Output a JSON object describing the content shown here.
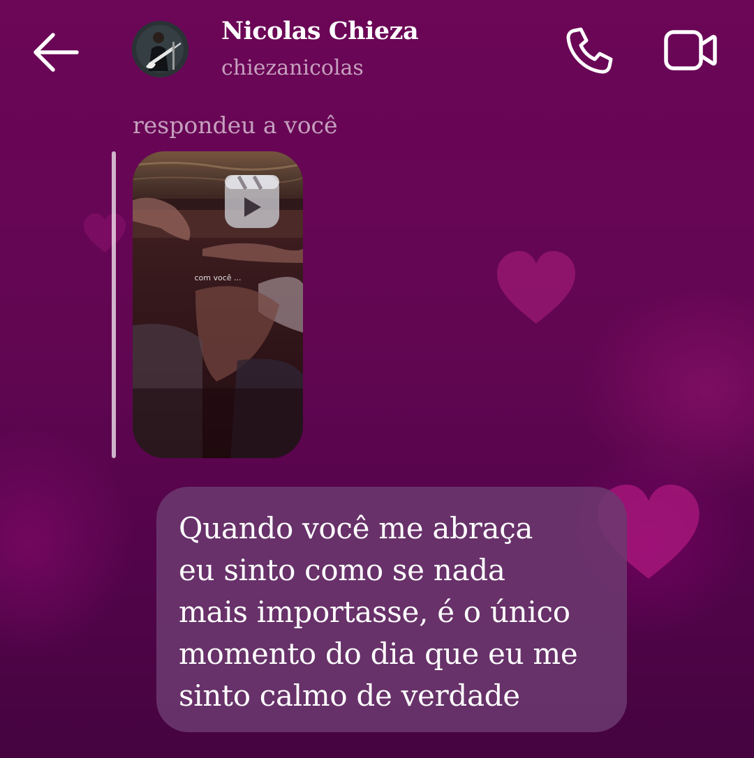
{
  "header": {
    "back_icon": "arrow-left-icon",
    "contact_name": "Nicolas Chieza",
    "contact_handle": "chiezanicolas",
    "call_icon": "phone-icon",
    "video_icon": "video-camera-icon"
  },
  "reply": {
    "label": "respondeu a você",
    "reel": {
      "icon": "reels-icon",
      "caption": "com você ..."
    }
  },
  "message": {
    "text": "Quando você me abraça\neu sinto como se nada\nmais importasse, é o único\nmomento do dia que eu me\nsinto calmo de verdade"
  },
  "colors": {
    "background": "#64065a",
    "bubble": "#6c3a70",
    "text": "#ffffff"
  }
}
